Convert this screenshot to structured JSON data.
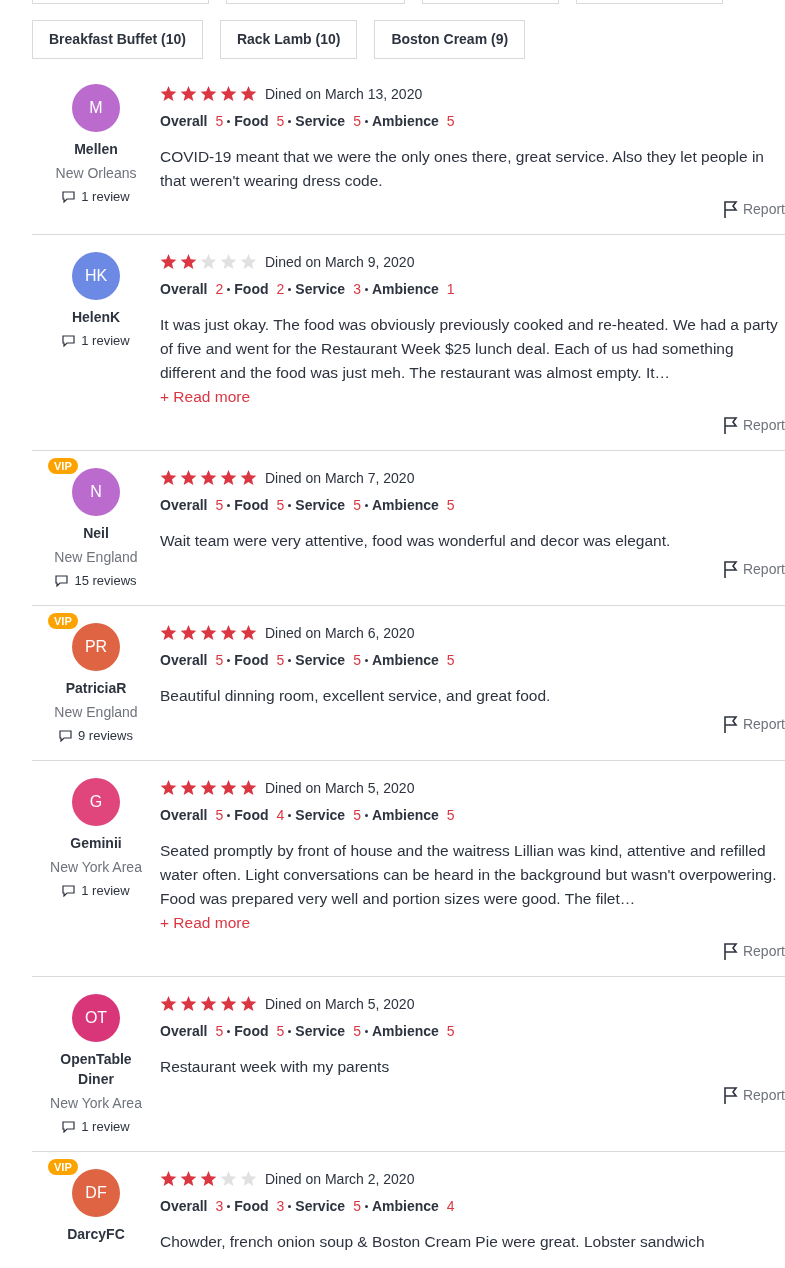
{
  "cut_tags": [
    {
      "kind": "cut"
    },
    {
      "kind": "cut"
    },
    {
      "kind": "cut"
    },
    {
      "kind": "cut"
    }
  ],
  "tags": [
    "Breakfast Buffet (10)",
    "Rack Lamb (10)",
    "Boston Cream (9)"
  ],
  "reviews": [
    {
      "initials": "M",
      "color": "#bb6acd",
      "vip": false,
      "name": "Mellen",
      "location": "New Orleans",
      "review_count": "1 review",
      "stars": 5,
      "dined": "Dined on March 13, 2020",
      "ratings": [
        {
          "label": "Overall",
          "value": "5"
        },
        {
          "label": "Food",
          "value": "5"
        },
        {
          "label": "Service",
          "value": "5"
        },
        {
          "label": "Ambience",
          "value": "5"
        }
      ],
      "text": "COVID-19 meant that we were the only ones there, great service. Also they let people in that weren't wearing dress code.",
      "report": "Report"
    },
    {
      "initials": "HK",
      "color": "#6c8ae4",
      "vip": false,
      "name": "HelenK",
      "review_count": "1 review",
      "stars": 2,
      "dined": "Dined on March 9, 2020",
      "ratings": [
        {
          "label": "Overall",
          "value": "2"
        },
        {
          "label": "Food",
          "value": "2"
        },
        {
          "label": "Service",
          "value": "3"
        },
        {
          "label": "Ambience",
          "value": "1"
        }
      ],
      "text": "It was just okay. The food was obviously previously cooked and re-heated. We had a party of five and went for the Restaurant Week $25 lunch deal. Each of us had something different and the food was just meh. The restaurant was almost empty. It…",
      "read_more": "+ Read more",
      "report": "Report"
    },
    {
      "initials": "N",
      "color": "#bb6acd",
      "vip": true,
      "vip_label": "VIP",
      "name": "Neil",
      "location": "New England",
      "review_count": "15 reviews",
      "stars": 5,
      "dined": "Dined on March 7, 2020",
      "ratings": [
        {
          "label": "Overall",
          "value": "5"
        },
        {
          "label": "Food",
          "value": "5"
        },
        {
          "label": "Service",
          "value": "5"
        },
        {
          "label": "Ambience",
          "value": "5"
        }
      ],
      "text": "Wait team were very attentive, food was wonderful and decor was elegant.",
      "report": "Report"
    },
    {
      "initials": "PR",
      "color": "#df6443",
      "vip": true,
      "vip_label": "VIP",
      "name": "PatriciaR",
      "location": "New England",
      "review_count": "9 reviews",
      "stars": 5,
      "dined": "Dined on March 6, 2020",
      "ratings": [
        {
          "label": "Overall",
          "value": "5"
        },
        {
          "label": "Food",
          "value": "5"
        },
        {
          "label": "Service",
          "value": "5"
        },
        {
          "label": "Ambience",
          "value": "5"
        }
      ],
      "text": "Beautiful dinning room, excellent service, and great food.",
      "report": "Report"
    },
    {
      "initials": "G",
      "color": "#e0457b",
      "vip": false,
      "name": "Geminii",
      "location": "New York Area",
      "review_count": "1 review",
      "stars": 5,
      "dined": "Dined on March 5, 2020",
      "ratings": [
        {
          "label": "Overall",
          "value": "5"
        },
        {
          "label": "Food",
          "value": "4"
        },
        {
          "label": "Service",
          "value": "5"
        },
        {
          "label": "Ambience",
          "value": "5"
        }
      ],
      "text": "Seated promptly by front of house and the waitress Lillian was kind, attentive and refilled water often. Light conversations can be heard in the background but wasn't overpowering. Food was prepared very well and portion sizes were good. The filet…",
      "read_more": "+ Read more",
      "report": "Report"
    },
    {
      "initials": "OT",
      "color": "#d9367a",
      "vip": false,
      "name": "OpenTable Diner",
      "location": "New York Area",
      "review_count": "1 review",
      "stars": 5,
      "dined": "Dined on March 5, 2020",
      "ratings": [
        {
          "label": "Overall",
          "value": "5"
        },
        {
          "label": "Food",
          "value": "5"
        },
        {
          "label": "Service",
          "value": "5"
        },
        {
          "label": "Ambience",
          "value": "5"
        }
      ],
      "text": "Restaurant week with my parents",
      "report": "Report"
    },
    {
      "initials": "DF",
      "color": "#df6443",
      "vip": true,
      "vip_label": "VIP",
      "name": "DarcyFC",
      "stars": 3,
      "dined": "Dined on March 2, 2020",
      "ratings": [
        {
          "label": "Overall",
          "value": "3"
        },
        {
          "label": "Food",
          "value": "3"
        },
        {
          "label": "Service",
          "value": "5"
        },
        {
          "label": "Ambience",
          "value": "4"
        }
      ],
      "text": "Chowder, french onion soup & Boston Cream Pie were great. Lobster sandwich"
    }
  ]
}
